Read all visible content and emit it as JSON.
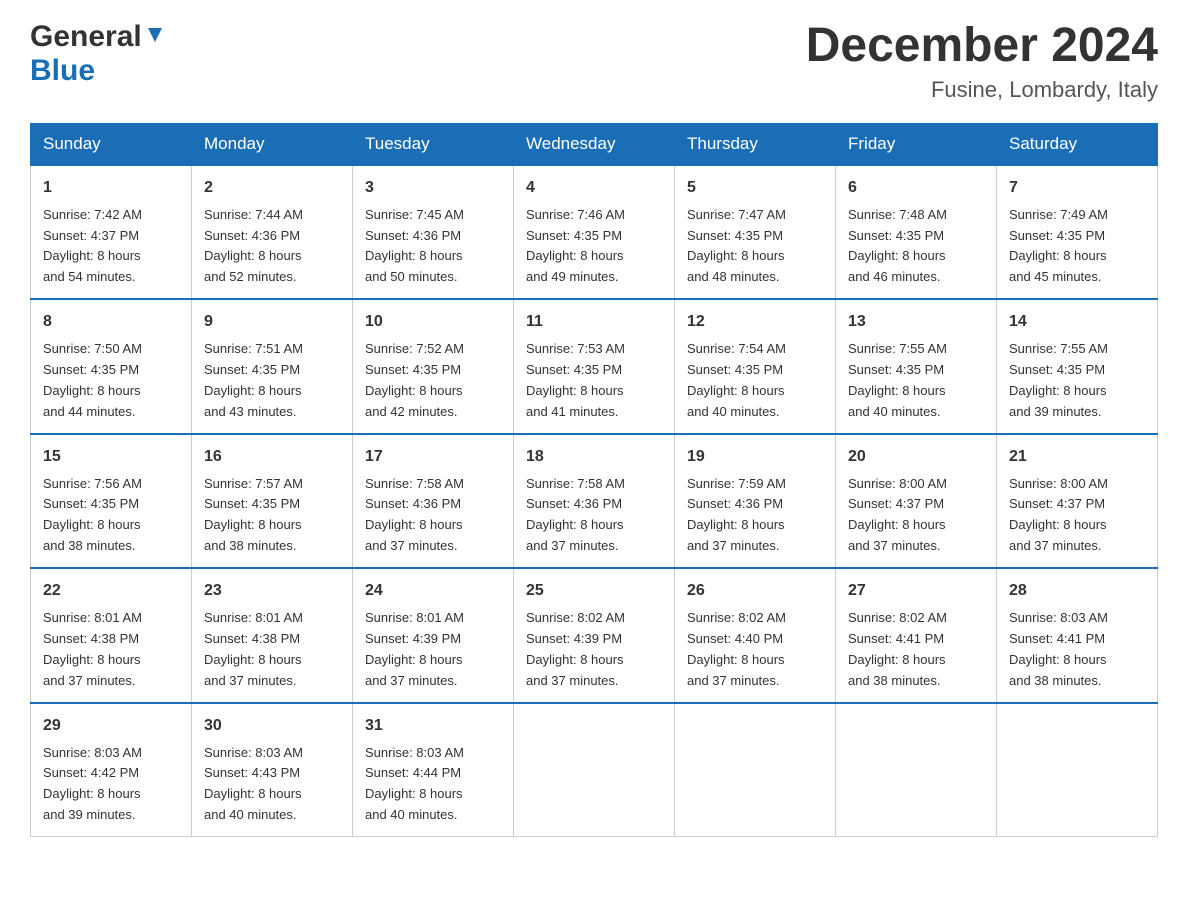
{
  "header": {
    "logo_general": "General",
    "logo_blue": "Blue",
    "month_title": "December 2024",
    "location": "Fusine, Lombardy, Italy"
  },
  "days_of_week": [
    "Sunday",
    "Monday",
    "Tuesday",
    "Wednesday",
    "Thursday",
    "Friday",
    "Saturday"
  ],
  "weeks": [
    [
      {
        "num": "1",
        "sunrise": "7:42 AM",
        "sunset": "4:37 PM",
        "daylight": "8 hours and 54 minutes."
      },
      {
        "num": "2",
        "sunrise": "7:44 AM",
        "sunset": "4:36 PM",
        "daylight": "8 hours and 52 minutes."
      },
      {
        "num": "3",
        "sunrise": "7:45 AM",
        "sunset": "4:36 PM",
        "daylight": "8 hours and 50 minutes."
      },
      {
        "num": "4",
        "sunrise": "7:46 AM",
        "sunset": "4:35 PM",
        "daylight": "8 hours and 49 minutes."
      },
      {
        "num": "5",
        "sunrise": "7:47 AM",
        "sunset": "4:35 PM",
        "daylight": "8 hours and 48 minutes."
      },
      {
        "num": "6",
        "sunrise": "7:48 AM",
        "sunset": "4:35 PM",
        "daylight": "8 hours and 46 minutes."
      },
      {
        "num": "7",
        "sunrise": "7:49 AM",
        "sunset": "4:35 PM",
        "daylight": "8 hours and 45 minutes."
      }
    ],
    [
      {
        "num": "8",
        "sunrise": "7:50 AM",
        "sunset": "4:35 PM",
        "daylight": "8 hours and 44 minutes."
      },
      {
        "num": "9",
        "sunrise": "7:51 AM",
        "sunset": "4:35 PM",
        "daylight": "8 hours and 43 minutes."
      },
      {
        "num": "10",
        "sunrise": "7:52 AM",
        "sunset": "4:35 PM",
        "daylight": "8 hours and 42 minutes."
      },
      {
        "num": "11",
        "sunrise": "7:53 AM",
        "sunset": "4:35 PM",
        "daylight": "8 hours and 41 minutes."
      },
      {
        "num": "12",
        "sunrise": "7:54 AM",
        "sunset": "4:35 PM",
        "daylight": "8 hours and 40 minutes."
      },
      {
        "num": "13",
        "sunrise": "7:55 AM",
        "sunset": "4:35 PM",
        "daylight": "8 hours and 40 minutes."
      },
      {
        "num": "14",
        "sunrise": "7:55 AM",
        "sunset": "4:35 PM",
        "daylight": "8 hours and 39 minutes."
      }
    ],
    [
      {
        "num": "15",
        "sunrise": "7:56 AM",
        "sunset": "4:35 PM",
        "daylight": "8 hours and 38 minutes."
      },
      {
        "num": "16",
        "sunrise": "7:57 AM",
        "sunset": "4:35 PM",
        "daylight": "8 hours and 38 minutes."
      },
      {
        "num": "17",
        "sunrise": "7:58 AM",
        "sunset": "4:36 PM",
        "daylight": "8 hours and 37 minutes."
      },
      {
        "num": "18",
        "sunrise": "7:58 AM",
        "sunset": "4:36 PM",
        "daylight": "8 hours and 37 minutes."
      },
      {
        "num": "19",
        "sunrise": "7:59 AM",
        "sunset": "4:36 PM",
        "daylight": "8 hours and 37 minutes."
      },
      {
        "num": "20",
        "sunrise": "8:00 AM",
        "sunset": "4:37 PM",
        "daylight": "8 hours and 37 minutes."
      },
      {
        "num": "21",
        "sunrise": "8:00 AM",
        "sunset": "4:37 PM",
        "daylight": "8 hours and 37 minutes."
      }
    ],
    [
      {
        "num": "22",
        "sunrise": "8:01 AM",
        "sunset": "4:38 PM",
        "daylight": "8 hours and 37 minutes."
      },
      {
        "num": "23",
        "sunrise": "8:01 AM",
        "sunset": "4:38 PM",
        "daylight": "8 hours and 37 minutes."
      },
      {
        "num": "24",
        "sunrise": "8:01 AM",
        "sunset": "4:39 PM",
        "daylight": "8 hours and 37 minutes."
      },
      {
        "num": "25",
        "sunrise": "8:02 AM",
        "sunset": "4:39 PM",
        "daylight": "8 hours and 37 minutes."
      },
      {
        "num": "26",
        "sunrise": "8:02 AM",
        "sunset": "4:40 PM",
        "daylight": "8 hours and 37 minutes."
      },
      {
        "num": "27",
        "sunrise": "8:02 AM",
        "sunset": "4:41 PM",
        "daylight": "8 hours and 38 minutes."
      },
      {
        "num": "28",
        "sunrise": "8:03 AM",
        "sunset": "4:41 PM",
        "daylight": "8 hours and 38 minutes."
      }
    ],
    [
      {
        "num": "29",
        "sunrise": "8:03 AM",
        "sunset": "4:42 PM",
        "daylight": "8 hours and 39 minutes."
      },
      {
        "num": "30",
        "sunrise": "8:03 AM",
        "sunset": "4:43 PM",
        "daylight": "8 hours and 40 minutes."
      },
      {
        "num": "31",
        "sunrise": "8:03 AM",
        "sunset": "4:44 PM",
        "daylight": "8 hours and 40 minutes."
      },
      null,
      null,
      null,
      null
    ]
  ],
  "labels": {
    "sunrise_prefix": "Sunrise: ",
    "sunset_prefix": "Sunset: ",
    "daylight_prefix": "Daylight: "
  }
}
